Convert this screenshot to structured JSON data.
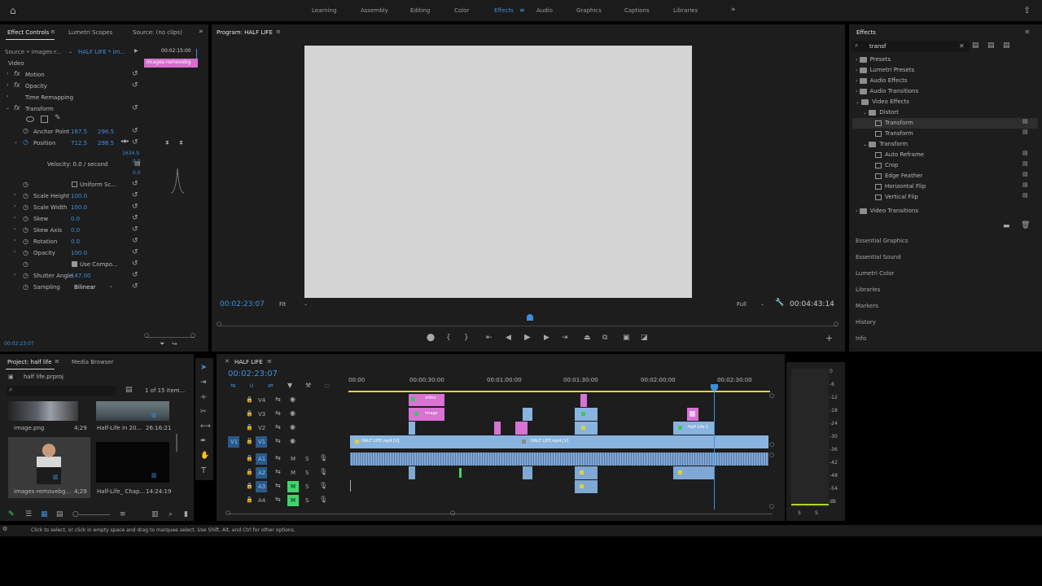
{
  "topbar": {
    "workspaces": [
      "Learning",
      "Assembly",
      "Editing",
      "Color",
      "Effects",
      "Audio",
      "Graphics",
      "Captions",
      "Libraries"
    ],
    "active_workspace": "Effects"
  },
  "effect_controls": {
    "tabs": [
      "Effect Controls",
      "Lumetri Scopes",
      "Source: (no clips)"
    ],
    "source_label": "Source • images-r...",
    "sequence_label": "HALF LIFE * im...",
    "timecode": "00:02:15:00",
    "clip_label": "images-removebg",
    "section": "Video",
    "effects": [
      "Motion",
      "Opacity",
      "Time Remapping",
      "Transform"
    ],
    "anchor_point": {
      "label": "Anchor Point",
      "x": "167.5",
      "y": "298.5"
    },
    "position": {
      "label": "Position",
      "x": "712.5",
      "y": "298.5"
    },
    "graph_top": "1634.9",
    "graph_zero": "0.0",
    "graph_zero2": "0.0",
    "velocity": "Velocity: 0.0 / second",
    "uniform_scale": "Uniform Sc...",
    "scale_height": {
      "label": "Scale Height",
      "value": "100.0"
    },
    "scale_width": {
      "label": "Scale Width",
      "value": "100.0"
    },
    "skew": {
      "label": "Skew",
      "value": "0.0"
    },
    "skew_axis": {
      "label": "Skew Axis",
      "value": "0.0"
    },
    "rotation": {
      "label": "Rotation",
      "value": "0.0"
    },
    "opacity": {
      "label": "Opacity",
      "value": "100.0"
    },
    "use_comp": "Use Compo...",
    "shutter_angle": {
      "label": "Shutter Angle",
      "value": "147.00"
    },
    "sampling": {
      "label": "Sampling",
      "value": "Bilinear"
    },
    "bottom_timecode": "00:02:23:07"
  },
  "program": {
    "title": "Program: HALF LIFE",
    "timecode": "00:02:23:07",
    "fit": "Fit",
    "quality": "Full",
    "duration": "00:04:43:14"
  },
  "effects_panel": {
    "title": "Effects",
    "search": "transf",
    "tree": [
      {
        "label": "Presets",
        "level": 0,
        "kind": "folder"
      },
      {
        "label": "Lumetri Presets",
        "level": 0,
        "kind": "folder"
      },
      {
        "label": "Audio Effects",
        "level": 0,
        "kind": "folder"
      },
      {
        "label": "Audio Transitions",
        "level": 0,
        "kind": "folder"
      },
      {
        "label": "Video Effects",
        "level": 0,
        "kind": "folder"
      },
      {
        "label": "Distort",
        "level": 1,
        "kind": "folder"
      },
      {
        "label": "Transform",
        "level": 2,
        "kind": "fx"
      },
      {
        "label": "Transform",
        "level": 2,
        "kind": "fx"
      },
      {
        "label": "Transform",
        "level": 1,
        "kind": "folder"
      },
      {
        "label": "Auto Reframe",
        "level": 2,
        "kind": "fx"
      },
      {
        "label": "Crop",
        "level": 2,
        "kind": "fx"
      },
      {
        "label": "Edge Feather",
        "level": 2,
        "kind": "fx"
      },
      {
        "label": "Horizontal Flip",
        "level": 2,
        "kind": "fx"
      },
      {
        "label": "Vertical Flip",
        "level": 2,
        "kind": "fx"
      },
      {
        "label": "Video Transitions",
        "level": 0,
        "kind": "folder"
      }
    ],
    "side_panels": [
      "Essential Graphics",
      "Essential Sound",
      "Lumetri Color",
      "Libraries",
      "Markers",
      "History",
      "Info"
    ]
  },
  "project": {
    "tabs": [
      "Project: half life",
      "Media Browser"
    ],
    "file": "half life.prproj",
    "count": "1 of 15 item...",
    "items": [
      {
        "name": "image.png",
        "dur": "4;29"
      },
      {
        "name": "Half-Life in 20...",
        "dur": "26:16:21"
      },
      {
        "name": "images-removebg...",
        "dur": "4;29"
      },
      {
        "name": "Half-Life_ Chap...",
        "dur": "14:24:19"
      }
    ]
  },
  "timeline": {
    "title": "HALF LIFE",
    "timecode": "00:02:23:07",
    "ruler": [
      "00:00",
      "00:00:30:00",
      "00:01:00:00",
      "00:01:30:00",
      "00:02:00:00",
      "00:02:30:00"
    ],
    "video_tracks": [
      "V4",
      "V3",
      "V2",
      "V1"
    ],
    "audio_tracks": [
      "A1",
      "A2",
      "A3",
      "A4"
    ],
    "clip_labels": {
      "video": "video",
      "image": "image",
      "half": "Half Life 1",
      "v1a": "HALF LIFE.mp4 [V]",
      "v1b": "HALF LIFE.mp4 [V]"
    },
    "meter_labels": [
      "0",
      "-6",
      "-12",
      "-18",
      "-24",
      "-30",
      "-36",
      "-42",
      "-48",
      "-54",
      "dB"
    ],
    "meter_s": [
      "S",
      "S"
    ]
  },
  "status": "Click to select, or click in empty space and drag to marquee select. Use Shift, Alt, and Ctrl for other options."
}
